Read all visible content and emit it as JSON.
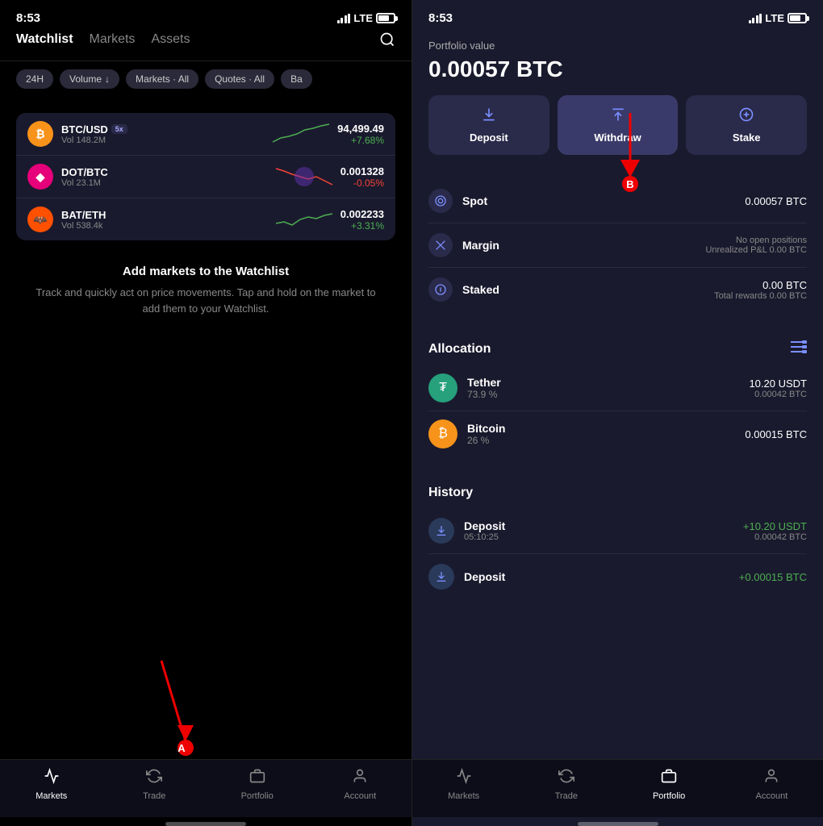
{
  "left": {
    "status": {
      "time": "8:53",
      "carrier": "LTE"
    },
    "nav_tabs": [
      {
        "label": "Watchlist",
        "active": true
      },
      {
        "label": "Markets",
        "active": false
      },
      {
        "label": "Assets",
        "active": false
      }
    ],
    "filter_chips": [
      {
        "label": "24H"
      },
      {
        "label": "Volume",
        "icon": "↓"
      },
      {
        "label": "Markets · All"
      },
      {
        "label": "Quotes · All"
      },
      {
        "label": "Ba"
      }
    ],
    "market_rows": [
      {
        "pair": "BTC/USD",
        "badge": "5x",
        "vol": "Vol 148.2M",
        "price": "94,499.49",
        "change": "+7.68%",
        "change_type": "up",
        "color": "#f7931a"
      },
      {
        "pair": "DOT/BTC",
        "vol": "Vol 23.1M",
        "price": "0.001328",
        "change": "-0.05%",
        "change_type": "down",
        "color": "#e6007a"
      },
      {
        "pair": "BAT/ETH",
        "vol": "Vol 538.4k",
        "price": "0.002233",
        "change": "+3.31%",
        "change_type": "up",
        "color": "#ff5000"
      }
    ],
    "empty_watchlist": {
      "title": "Add markets to the Watchlist",
      "desc": "Track and quickly act on price movements. Tap and hold on the market to add them to your Watchlist."
    },
    "bottom_nav": [
      {
        "label": "Markets",
        "active": true,
        "icon": "📈"
      },
      {
        "label": "Trade",
        "active": false,
        "icon": "🔄"
      },
      {
        "label": "Portfolio",
        "active": false,
        "icon": "🗂️"
      },
      {
        "label": "Account",
        "active": false,
        "icon": "👤"
      }
    ],
    "arrow_a_label": "A"
  },
  "right": {
    "status": {
      "time": "8:53",
      "carrier": "LTE"
    },
    "portfolio": {
      "label": "Portfolio value",
      "value": "0.00057 BTC"
    },
    "actions": [
      {
        "label": "Deposit",
        "icon": "↓",
        "active": false
      },
      {
        "label": "Withdraw",
        "icon": "↑",
        "active": true
      },
      {
        "label": "Stake",
        "icon": "⬇",
        "active": false
      }
    ],
    "balances": [
      {
        "label": "Spot",
        "icon": "⊙",
        "main": "0.00057 BTC",
        "sub": ""
      },
      {
        "label": "Margin",
        "icon": "✕",
        "main": "No open positions",
        "sub": "Unrealized P&L 0.00 BTC"
      },
      {
        "label": "Staked",
        "icon": "⬇",
        "main": "0.00 BTC",
        "sub": "Total rewards 0.00 BTC"
      }
    ],
    "allocation": {
      "title": "Allocation",
      "items": [
        {
          "name": "Tether",
          "pct": "73.9 %",
          "main": "10.20 USDT",
          "sub": "0.00042 BTC",
          "color": "#26a17b"
        },
        {
          "name": "Bitcoin",
          "pct": "26 %",
          "main": "0.00015 BTC",
          "sub": "",
          "color": "#f7931a"
        }
      ]
    },
    "history": {
      "title": "History",
      "items": [
        {
          "type": "Deposit",
          "time": "05:10:25",
          "main": "+10.20  USDT",
          "sub": "0.00042 BTC"
        },
        {
          "type": "Deposit",
          "time": "",
          "main": "+0.00015 BTC",
          "sub": ""
        }
      ]
    },
    "bottom_nav": [
      {
        "label": "Markets",
        "active": false,
        "icon": "📈"
      },
      {
        "label": "Trade",
        "active": false,
        "icon": "🔄"
      },
      {
        "label": "Portfolio",
        "active": true,
        "icon": "🗂️"
      },
      {
        "label": "Account",
        "active": false,
        "icon": "👤"
      }
    ],
    "arrow_b_label": "B"
  }
}
